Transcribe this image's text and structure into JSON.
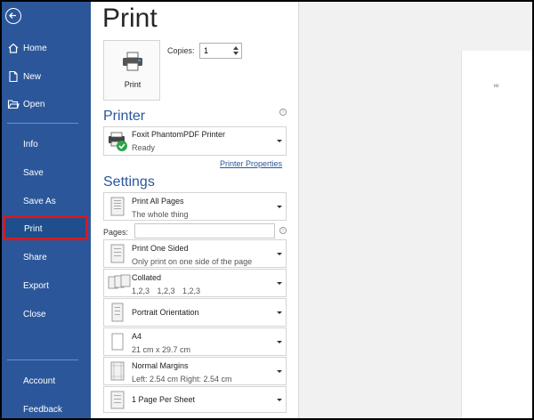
{
  "sidebar": {
    "back_icon": "back-arrow-icon",
    "items": [
      {
        "label": "Home",
        "icon": "home-icon"
      },
      {
        "label": "New",
        "icon": "new-document-icon"
      },
      {
        "label": "Open",
        "icon": "open-folder-icon"
      },
      {
        "label": "Info"
      },
      {
        "label": "Save"
      },
      {
        "label": "Save As"
      },
      {
        "label": "Print",
        "selected": true
      },
      {
        "label": "Share"
      },
      {
        "label": "Export"
      },
      {
        "label": "Close"
      },
      {
        "label": "Account"
      },
      {
        "label": "Feedback"
      }
    ],
    "selected_outline_color": "#d71920",
    "background_color": "#2b579a"
  },
  "main": {
    "title": "Print",
    "print_button_label": "Print",
    "copies_label": "Copies:",
    "copies_value": "1",
    "printer_heading": "Printer",
    "printer": {
      "name": "Foxit PhantomPDF Printer",
      "status": "Ready"
    },
    "printer_properties_link": "Printer Properties",
    "settings_heading": "Settings",
    "settings": [
      {
        "line1": "Print All Pages",
        "line2": "The whole thing"
      },
      {
        "line1": "Print One Sided",
        "line2": "Only print on one side of the page"
      },
      {
        "line1": "Collated",
        "line2": "1,2,3    1,2,3    1,2,3"
      },
      {
        "line1": "Portrait Orientation",
        "line2": ""
      },
      {
        "line1": "A4",
        "line2": "21 cm x 29.7 cm"
      },
      {
        "line1": "Normal Margins",
        "line2": "Left:  2.54 cm    Right:  2.54 cm"
      },
      {
        "line1": "1 Page Per Sheet",
        "line2": ""
      }
    ],
    "pages_label": "Pages:",
    "pages_value": "",
    "info_icon": "info-icon",
    "accent_color": "#2b579a"
  },
  "preview": {
    "page_mark": "ııı"
  }
}
